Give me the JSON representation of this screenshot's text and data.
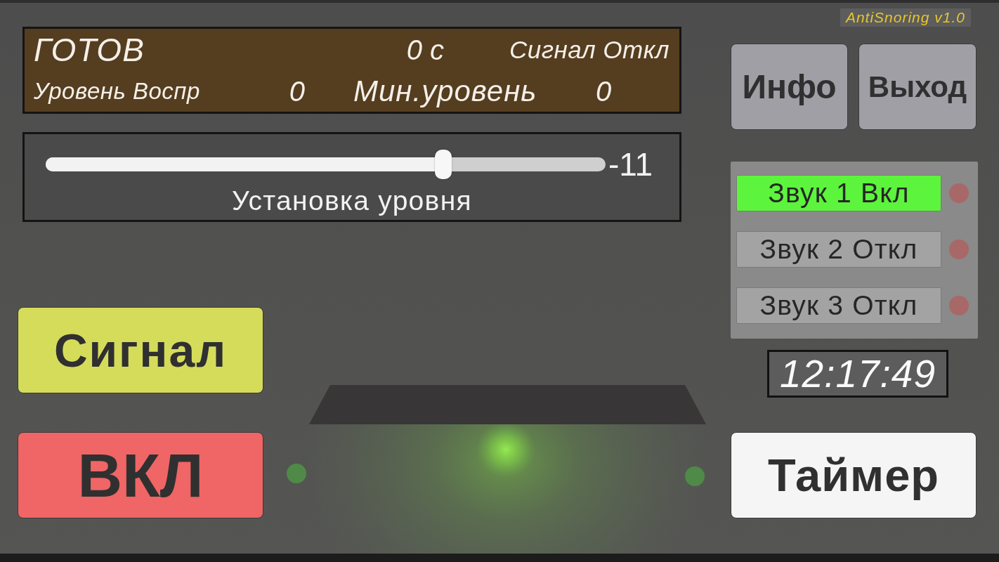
{
  "app_label": "AntiSnoring v1.0",
  "status_display": {
    "state": "ГОТОВ",
    "elapsed": "0 с",
    "signal_status": "Сигнал Откл",
    "playback_label": "Уровень Воспр",
    "playback_value": "0",
    "min_level_label": "Мин.уровень",
    "min_level_value": "0"
  },
  "level_slider": {
    "level": 0.71,
    "reading": "-11",
    "label": "Установка уровня"
  },
  "header_buttons": [
    {
      "label": "Инфо"
    },
    {
      "label": "Выход"
    }
  ],
  "sound_toggles": [
    {
      "label": "Звук 1 Вкл",
      "on": true
    },
    {
      "label": "Звук 2 Откл",
      "on": false
    },
    {
      "label": "Звук 3 Откл",
      "on": false
    }
  ],
  "clock": "12:17:49",
  "signal_button": "Сигнал",
  "power_button": "ВКЛ",
  "timer_button": "Таймер"
}
